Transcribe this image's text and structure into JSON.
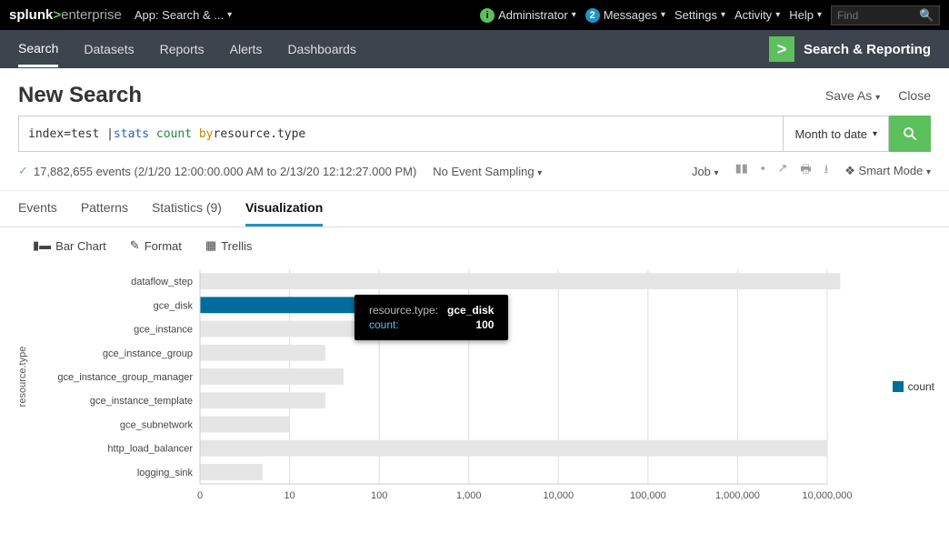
{
  "top": {
    "logo_main": "splunk",
    "logo_gt": ">",
    "logo_sub": "enterprise",
    "app_label": "App: Search & ...",
    "admin_badge": "i",
    "admin_label": "Administrator",
    "msg_badge": "2",
    "msg_label": "Messages",
    "settings_label": "Settings",
    "activity_label": "Activity",
    "help_label": "Help",
    "find_placeholder": "Find"
  },
  "nav": {
    "items": [
      "Search",
      "Datasets",
      "Reports",
      "Alerts",
      "Dashboards"
    ],
    "app_title": "Search & Reporting"
  },
  "page": {
    "title": "New Search",
    "save_as": "Save As",
    "close": "Close"
  },
  "search": {
    "prefix": "index=test | ",
    "kw1": "stats",
    "kw2": "count",
    "kw3": "by",
    "tail": " resource.type",
    "time_range": "Month to date"
  },
  "status": {
    "summary": "17,882,655 events (2/1/20 12:00:00.000 AM to 2/13/20 12:12:27.000 PM)",
    "sampling": "No Event Sampling",
    "job": "Job",
    "mode": "Smart Mode"
  },
  "result_tabs": {
    "events": "Events",
    "patterns": "Patterns",
    "statistics": "Statistics (9)",
    "viz": "Visualization"
  },
  "viz_toolbar": {
    "type": "Bar Chart",
    "format": "Format",
    "trellis": "Trellis"
  },
  "tooltip": {
    "k1": "resource.type:",
    "v1": "gce_disk",
    "k2": "count:",
    "v2": "100"
  },
  "legend": {
    "label": "count"
  },
  "chart_data": {
    "type": "bar",
    "orientation": "horizontal",
    "xscale": "log",
    "xlabel": "",
    "ylabel": "resource.type",
    "highlight": "gce_disk",
    "xticks": [
      0,
      10,
      100,
      1000,
      10000,
      100000,
      1000000,
      10000000
    ],
    "xtick_labels": [
      "0",
      "10",
      "100",
      "1,000",
      "10,000",
      "100,000",
      "1,000,000",
      "10,000,000"
    ],
    "categories": [
      "dataflow_step",
      "gce_disk",
      "gce_instance",
      "gce_instance_group",
      "gce_instance_group_manager",
      "gce_instance_template",
      "gce_subnetwork",
      "http_load_balancer",
      "logging_sink"
    ],
    "values": [
      14000000,
      100,
      60,
      25,
      40,
      25,
      10,
      10000000,
      5
    ],
    "legend": "count",
    "color": "#006d9c",
    "bar_fill": "#e5e5e5"
  }
}
